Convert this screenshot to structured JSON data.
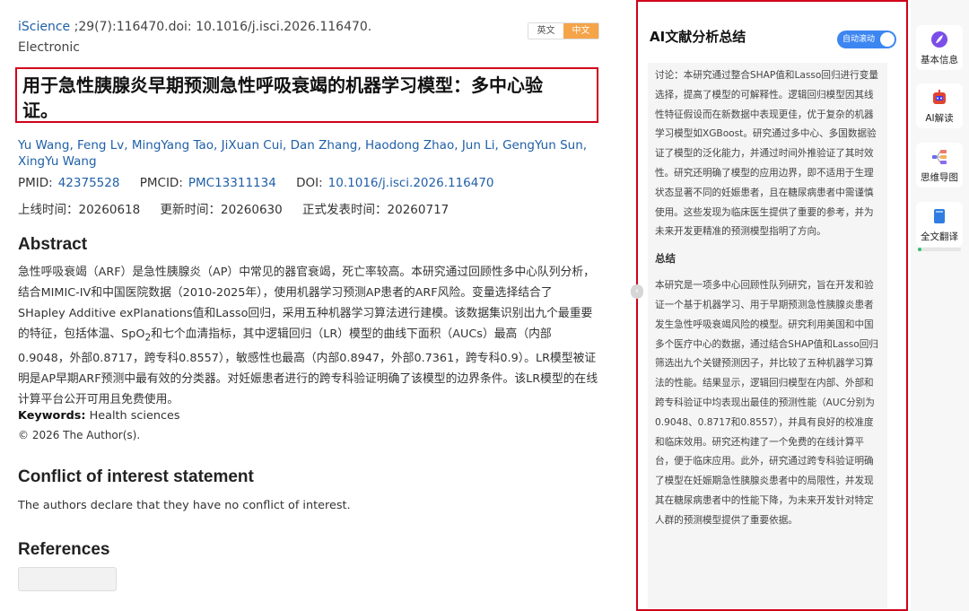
{
  "article": {
    "journal": "iScience",
    "citation": " ;29(7):116470.doi: 10.1016/j.isci.2026.116470.",
    "pub_type": "Electronic",
    "lang_en": "英文",
    "lang_zh": "中文",
    "title_line1": "用于急性胰腺炎早期预测急性呼吸衰竭的机器学习模型：多中心验",
    "title_line2": "证。",
    "authors": [
      "Yu Wang",
      "Feng Lv",
      "MingYang Tao",
      "JiXuan Cui",
      "Dan Zhang",
      "Haodong Zhao",
      "Jun Li",
      "GengYun Sun",
      "XingYu Wang"
    ],
    "pmid_label": "PMID:",
    "pmid": "42375528",
    "pmcid_label": "PMCID:",
    "pmcid": "PMC13311134",
    "doi_label": "DOI:",
    "doi": "10.1016/j.isci.2026.116470",
    "online_date": "上线时间：20260618",
    "update_date": "更新时间：20260630",
    "publish_date": "正式发表时间：20260717",
    "abstract_heading": "Abstract",
    "abstract_part1": "急性呼吸衰竭（ARF）是急性胰腺炎（AP）中常见的器官衰竭，死亡率较高。本研究通过回顾性多中心队列分析，结合MIMIC-IV和中国医院数据（2010-2025年），使用机器学习预测AP患者的ARF风险。变量选择结合了SHapley Additive exPlanations值和Lasso回归，采用五种机器学习算法进行建模。该数据集识别出九个最重要的特征，包括体温、SpO",
    "abstract_sub": "2",
    "abstract_part2": "和七个血清指标，其中逻辑回归（LR）模型的曲线下面积（AUCs）最高（内部0.9048，外部0.8717，跨专科0.8557），敏感性也最高（内部0.8947，外部0.7361，跨专科0.9）。LR模型被证明是AP早期ARF预测中最有效的分类器。对妊娠患者进行的跨专科验证明确了该模型的边界条件。该LR模型的在线计算平台公开可用且免费使用。",
    "keywords_label": "Keywords:",
    "keywords_value": " Health sciences",
    "copyright": "© 2026 The Author(s).",
    "conflict_heading": "Conflict of interest statement",
    "conflict_body": "The authors declare that they have no conflict of interest.",
    "references_heading": "References"
  },
  "ai_panel": {
    "title": "AI文献分析总结",
    "toggle_label": "自动滚动",
    "toggle_on": true,
    "discussion": "讨论：本研究通过整合SHAP值和Lasso回归进行变量选择，提高了模型的可解释性。逻辑回归模型因其线性特征假设而在新数据中表现更佳，优于复杂的机器学习模型如XGBoost。研究通过多中心、多国数据验证了模型的泛化能力，并通过时间外推验证了其时效性。研究还明确了模型的应用边界，即不适用于生理状态显著不同的妊娠患者，且在糖尿病患者中需谨慎使用。这些发现为临床医生提供了重要的参考，并为未来开发更精准的预测模型指明了方向。",
    "summary_heading": "总结",
    "summary": "本研究是一项多中心回顾性队列研究，旨在开发和验证一个基于机器学习、用于早期预测急性胰腺炎患者发生急性呼吸衰竭风险的模型。研究利用美国和中国多个医疗中心的数据，通过结合SHAP值和Lasso回归筛选出九个关键预测因子，并比较了五种机器学习算法的性能。结果显示，逻辑回归模型在内部、外部和跨专科验证中均表现出最佳的预测性能（AUC分别为0.9048、0.8717和0.8557），并具有良好的校准度和临床效用。研究还构建了一个免费的在线计算平台，便于临床应用。此外，研究通过跨专科验证明确了模型在妊娠期急性胰腺炎患者中的局限性，并发现其在糖尿病患者中的性能下降，为未来开发针对特定人群的预测模型提供了重要依据。"
  },
  "rail": {
    "items": [
      {
        "label": "基本信息",
        "icon": "feather-icon",
        "color": "#7b4ee8"
      },
      {
        "label": "AI解读",
        "icon": "robot-icon",
        "color": "#e0442e"
      },
      {
        "label": "思维导图",
        "icon": "mindmap-icon",
        "color": "#6b6bf0"
      },
      {
        "label": "全文翻译",
        "icon": "book-icon",
        "color": "#2f7de1"
      }
    ],
    "translate_progress": 0.08
  },
  "colors": {
    "link": "#1f5fa8",
    "highlight_border": "#d0021b",
    "lang_active": "#f5a44a",
    "toggle": "#3d86f2"
  }
}
